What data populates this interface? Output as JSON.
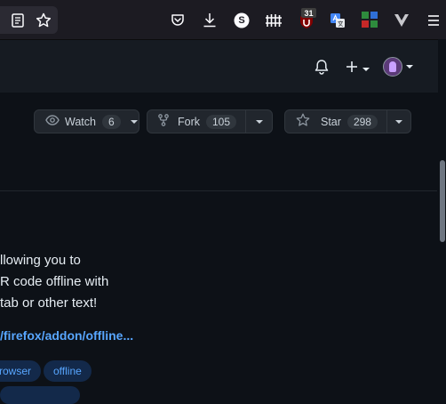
{
  "browser": {
    "toolbar_icons": [
      "reader-view-icon",
      "bookmark-star-icon",
      "pocket-icon",
      "downloads-icon",
      "s-extension-icon",
      "fence-extension-icon",
      "ublock-icon",
      "translate-icon",
      "tiles-extension-icon",
      "vivaldi-v-icon",
      "menu-icon"
    ],
    "ublock_badge": "31",
    "s_extension_letter": "S"
  },
  "header": {
    "icons": [
      "notifications-bell-icon",
      "plus-icon",
      "avatar"
    ]
  },
  "repo_actions": {
    "watch": {
      "label": "Watch",
      "count": "6"
    },
    "fork": {
      "label": "Fork",
      "count": "105"
    },
    "star": {
      "label": "Star",
      "count": "298"
    }
  },
  "about": {
    "description_lines": [
      "llowing you to",
      "R code offline with",
      "tab or other text!"
    ],
    "link": "/firefox/addon/offline..."
  },
  "topics": [
    "rowser",
    "offline"
  ],
  "colors": {
    "page_bg": "#0d1117",
    "header_bg": "#161b22",
    "browser_bg": "#1c1b22",
    "button_bg": "#21262d",
    "border": "#30363d",
    "link": "#58a6ff",
    "topic_bg": "#13294a",
    "text": "#e6edf3"
  }
}
